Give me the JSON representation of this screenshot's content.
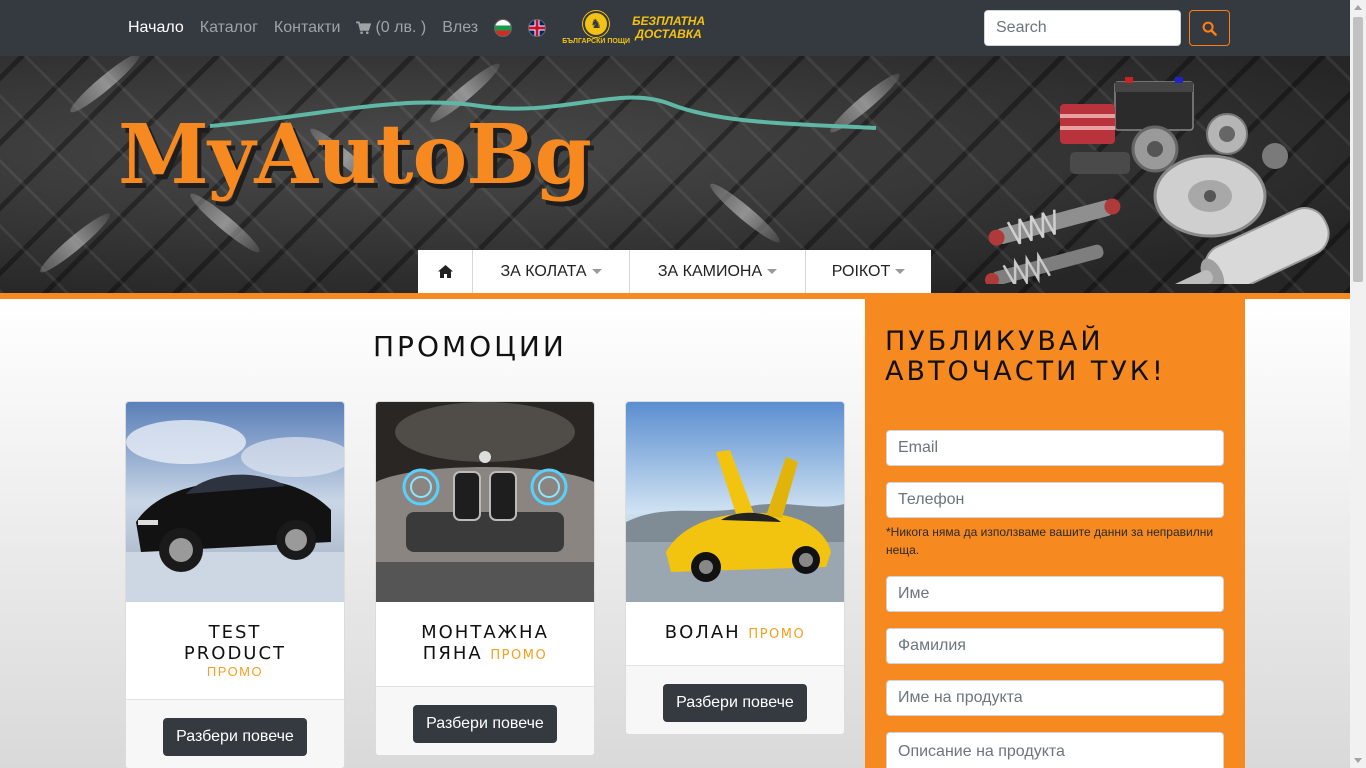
{
  "navbar": {
    "links": [
      "Начало",
      "Каталог",
      "Контакти"
    ],
    "cart_label": "(0 лв. )",
    "login_label": "Влез",
    "post_logo_text": "БЪЛГАРСКИ ПОЩИ",
    "free_delivery_line1": "БЕЗПЛАТНА",
    "free_delivery_line2": "ДОСТАВКА",
    "search_placeholder": "Search"
  },
  "hero": {
    "logo": "MyAutoBg",
    "menu": [
      "ЗА КОЛАТА",
      "ЗА КАМИОНА",
      "РОІКОТ"
    ]
  },
  "promotions": {
    "title": "ПРОМОЦИИ",
    "badge": "ПРОМО",
    "button_label": "Разбери повече",
    "products": [
      {
        "line1": "TEST",
        "line2": "PRODUCT"
      },
      {
        "line1": "МОНТАЖНА",
        "line2": "ПЯНА"
      },
      {
        "line1": "ВОЛАН"
      }
    ]
  },
  "sidebar": {
    "title_line1": "ПУБЛИКУВАЙ",
    "title_line2": "АВТОЧАСТИ ТУК!",
    "email_placeholder": "Email",
    "phone_placeholder": "Телефон",
    "note": "*Никога няма да използваме вашите данни за неправилни неща.",
    "first_name_placeholder": "Име",
    "last_name_placeholder": "Фамилия",
    "product_name_placeholder": "Име на продукта",
    "product_desc_placeholder": "Описание на продукта"
  },
  "colors": {
    "brand_orange": "#f6891f",
    "navbar": "#343a40",
    "promo_badge": "#f6a01f",
    "delivery_yellow": "#f4c214"
  },
  "icons": [
    "cart-icon",
    "search-icon",
    "home-icon",
    "flag-bg-icon",
    "flag-en-icon",
    "caret-down-icon"
  ]
}
